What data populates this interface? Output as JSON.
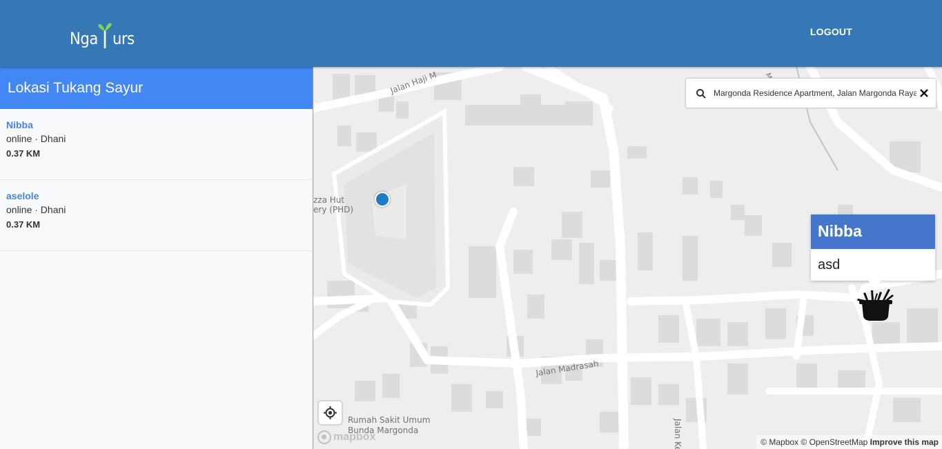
{
  "header": {
    "logo_left": "Nga",
    "logo_right": "urs",
    "logout_label": "LOGOUT",
    "accent_color": "#3678b6"
  },
  "sidebar": {
    "title": "Lokasi Tukang Sayur",
    "vendors": [
      {
        "name": "Nibba",
        "status": "online · Dhani",
        "distance": "0.37 KM"
      },
      {
        "name": "aselole",
        "status": "online · Dhani",
        "distance": "0.37 KM"
      }
    ]
  },
  "map": {
    "search_value": "Margonda Residence Apartment, Jalan Margonda Raya",
    "labels": {
      "jalan_haji": "Jalan Haji M",
      "pizza_hut_1": "zza Hut",
      "pizza_hut_2": "ery (PHD)",
      "jalan_madrasah": "Jalan Madrasah",
      "rs_1": "Rumah Sakit Umum",
      "rs_2": "Bunda Margonda",
      "jalan_kedoya": "Jalan Kedoy",
      "jalan_top": "M"
    },
    "popup": {
      "title": "Nibba",
      "body": "asd"
    },
    "logo_text": "mapbox",
    "attribution": {
      "mapbox": "© Mapbox",
      "osm": "© OpenStreetMap",
      "improve": "Improve this map"
    },
    "icons": [
      "search-icon",
      "close-icon",
      "geolocate-icon",
      "vegetable-basket-icon",
      "mapbox-logo-icon"
    ]
  }
}
